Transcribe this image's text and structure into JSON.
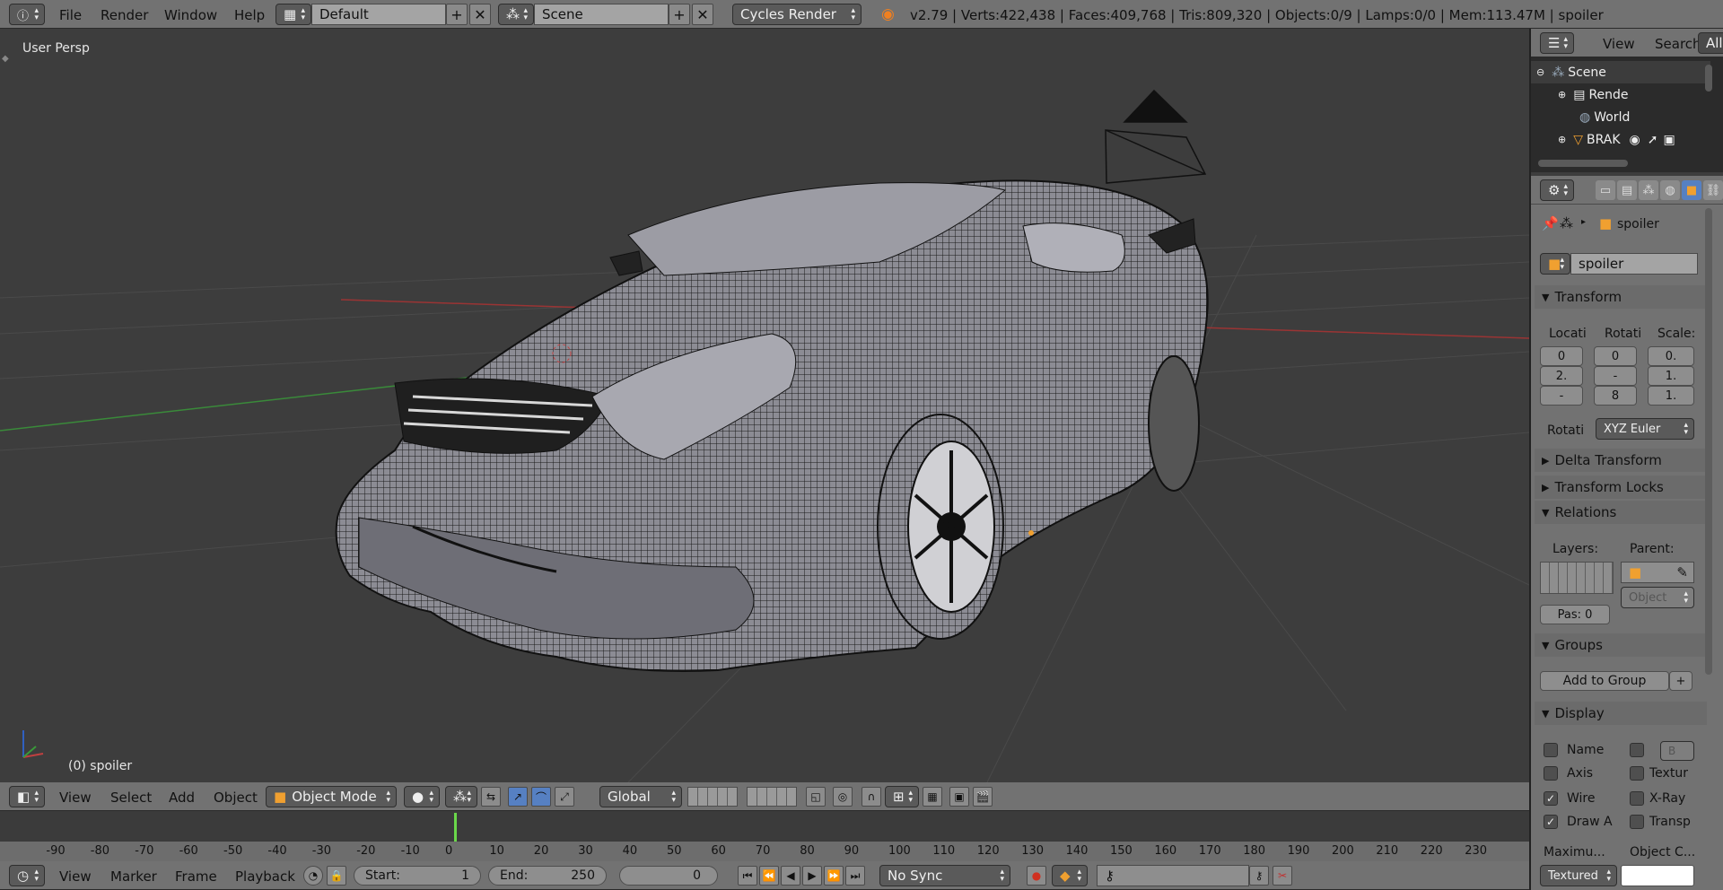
{
  "topbar": {
    "menus": [
      "File",
      "Render",
      "Window",
      "Help"
    ],
    "layout": "Default",
    "scene": "Scene",
    "engine": "Cycles Render",
    "stats": "v2.79 | Verts:422,438 | Faces:409,768 | Tris:809,320 | Objects:0/9 | Lamps:0/0 | Mem:113.47M | spoiler"
  },
  "viewport": {
    "view_label": "User Persp",
    "object_label": "(0) spoiler"
  },
  "outliner": {
    "menu_view": "View",
    "menu_search": "Search",
    "menu_all": "All",
    "items": [
      {
        "label": "Scene",
        "icon": "scene-icon"
      },
      {
        "label": "Rende",
        "icon": "render-layers-icon"
      },
      {
        "label": "World",
        "icon": "world-icon"
      },
      {
        "label": "BRAK",
        "icon": "mesh-object-icon"
      }
    ]
  },
  "properties": {
    "breadcrumb_object": "spoiler",
    "object_name": "spoiler",
    "transform_header": "Transform",
    "col_location": "Locati",
    "col_rotation": "Rotati",
    "col_scale": "Scale:",
    "location": [
      "0",
      "2.",
      "-"
    ],
    "rotation": [
      "0",
      "-",
      "8"
    ],
    "scale": [
      "0.",
      "1.",
      "1."
    ],
    "rotation_mode_label": "Rotati",
    "rotation_mode": "XYZ Euler",
    "delta_header": "Delta Transform",
    "locks_header": "Transform Locks",
    "relations_header": "Relations",
    "layers_label": "Layers:",
    "parent_label": "Parent:",
    "parent_type": "Object",
    "pass_index": "Pas: 0",
    "groups_header": "Groups",
    "add_group": "Add to Group",
    "display_header": "Display",
    "display_left": [
      {
        "label": "Name",
        "checked": false
      },
      {
        "label": "Axis",
        "checked": false
      },
      {
        "label": "Wire",
        "checked": true
      },
      {
        "label": "Draw A",
        "checked": true
      }
    ],
    "display_right": [
      {
        "label": "",
        "checked": false
      },
      {
        "label": "Textur",
        "checked": false
      },
      {
        "label": "X-Ray",
        "checked": false
      },
      {
        "label": "Transp",
        "checked": false
      }
    ],
    "bounds_type": "B",
    "max_draw_label": "Maximu...",
    "object_color_label": "Object C...",
    "max_draw_value": "Textured"
  },
  "view3d_header": {
    "menus": [
      "View",
      "Select",
      "Add",
      "Object"
    ],
    "mode": "Object Mode",
    "orientation": "Global"
  },
  "timeline": {
    "ticks": [
      "-90",
      "-80",
      "-70",
      "-60",
      "-50",
      "-40",
      "-30",
      "-20",
      "-10",
      "0",
      "10",
      "20",
      "30",
      "40",
      "50",
      "60",
      "70",
      "80",
      "90",
      "100",
      "110",
      "120",
      "130",
      "140",
      "150",
      "160",
      "170",
      "180",
      "190",
      "200",
      "210",
      "220",
      "230"
    ],
    "current_frame_marker": 0
  },
  "timeline_header": {
    "menus": [
      "View",
      "Marker",
      "Frame",
      "Playback"
    ],
    "start_label": "Start:",
    "start_value": "1",
    "end_label": "End:",
    "end_value": "250",
    "current_frame": "0",
    "sync": "No Sync"
  },
  "colors": {
    "header_bg": "#727272",
    "viewport_bg": "#3d3d3d",
    "accent_orange": "#f0a030",
    "axis_red": "#b03838",
    "axis_green": "#3a8a3a",
    "frame_marker": "#6ad84a"
  }
}
